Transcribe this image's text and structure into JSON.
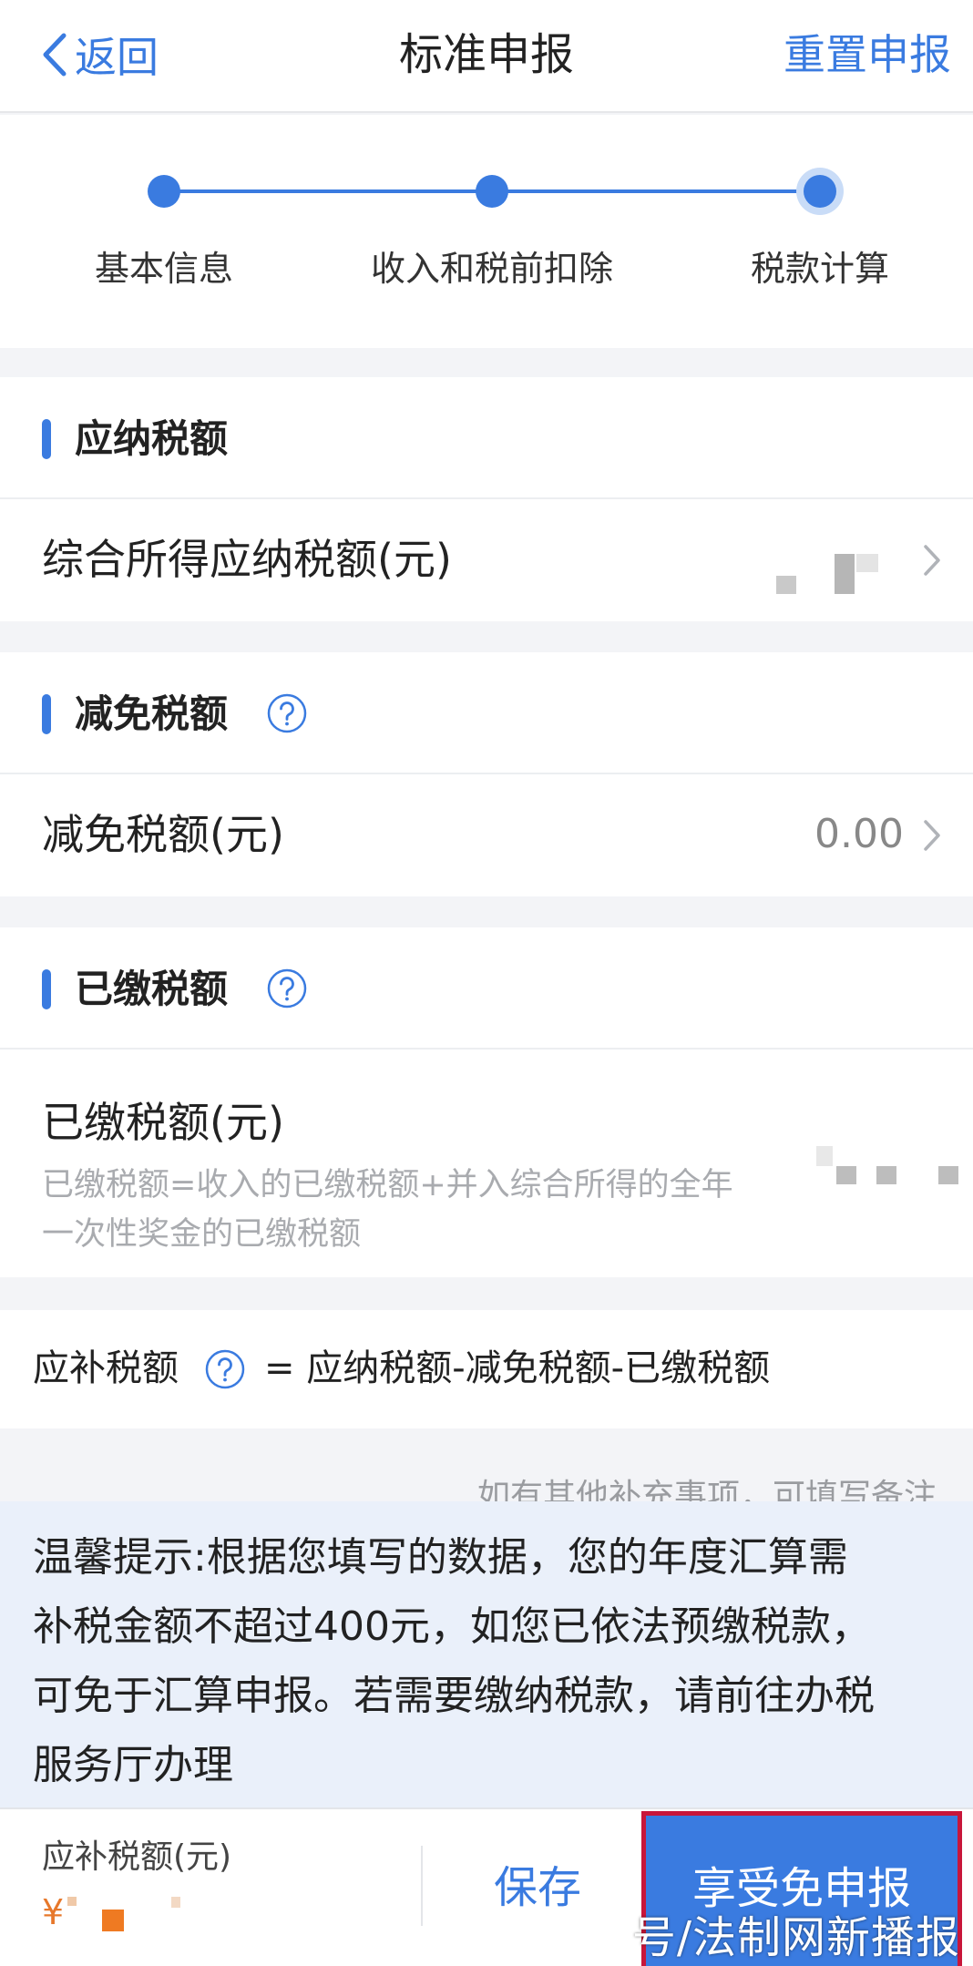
{
  "header": {
    "back_label": "返回",
    "title": "标准申报",
    "reset_label": "重置申报"
  },
  "stepper": {
    "steps": [
      {
        "label": "基本信息"
      },
      {
        "label": "收入和税前扣除"
      },
      {
        "label": "税款计算"
      }
    ]
  },
  "sections": {
    "payable": {
      "title": "应纳税额",
      "row_label": "综合所得应纳税额(元)"
    },
    "relief": {
      "title": "减免税额",
      "row_label": "减免税额(元)",
      "row_value": "0.00"
    },
    "paid": {
      "title": "已缴税额",
      "row_label": "已缴税额(元)",
      "note_line1": "已缴税额=收入的已缴税额+并入综合所得的全年",
      "note_line2": "一次性奖金的已缴税额"
    }
  },
  "formula": {
    "label": "应补税额",
    "text": "= 应纳税额-减免税额-已缴税额"
  },
  "remark": {
    "text": "如有其他补充事项，可填写备注"
  },
  "tip": {
    "line1": "温馨提示:根据您填写的数据，您的年度汇算需",
    "line2": "补税金额不超过400元，如您已依法预缴税款，",
    "line3": "可免于汇算申报。若需要缴纳税款，请前往办税",
    "line4": "服务厅办理"
  },
  "footer": {
    "label": "应补税额(元)",
    "currency": "¥",
    "save_label": "保存",
    "primary_label": "享受免申报"
  },
  "watermark": {
    "text": "号/法制网新播报"
  },
  "colors": {
    "accent": "#3a7be0",
    "highlight_border": "#c8163a",
    "amount": "#e7782b"
  }
}
